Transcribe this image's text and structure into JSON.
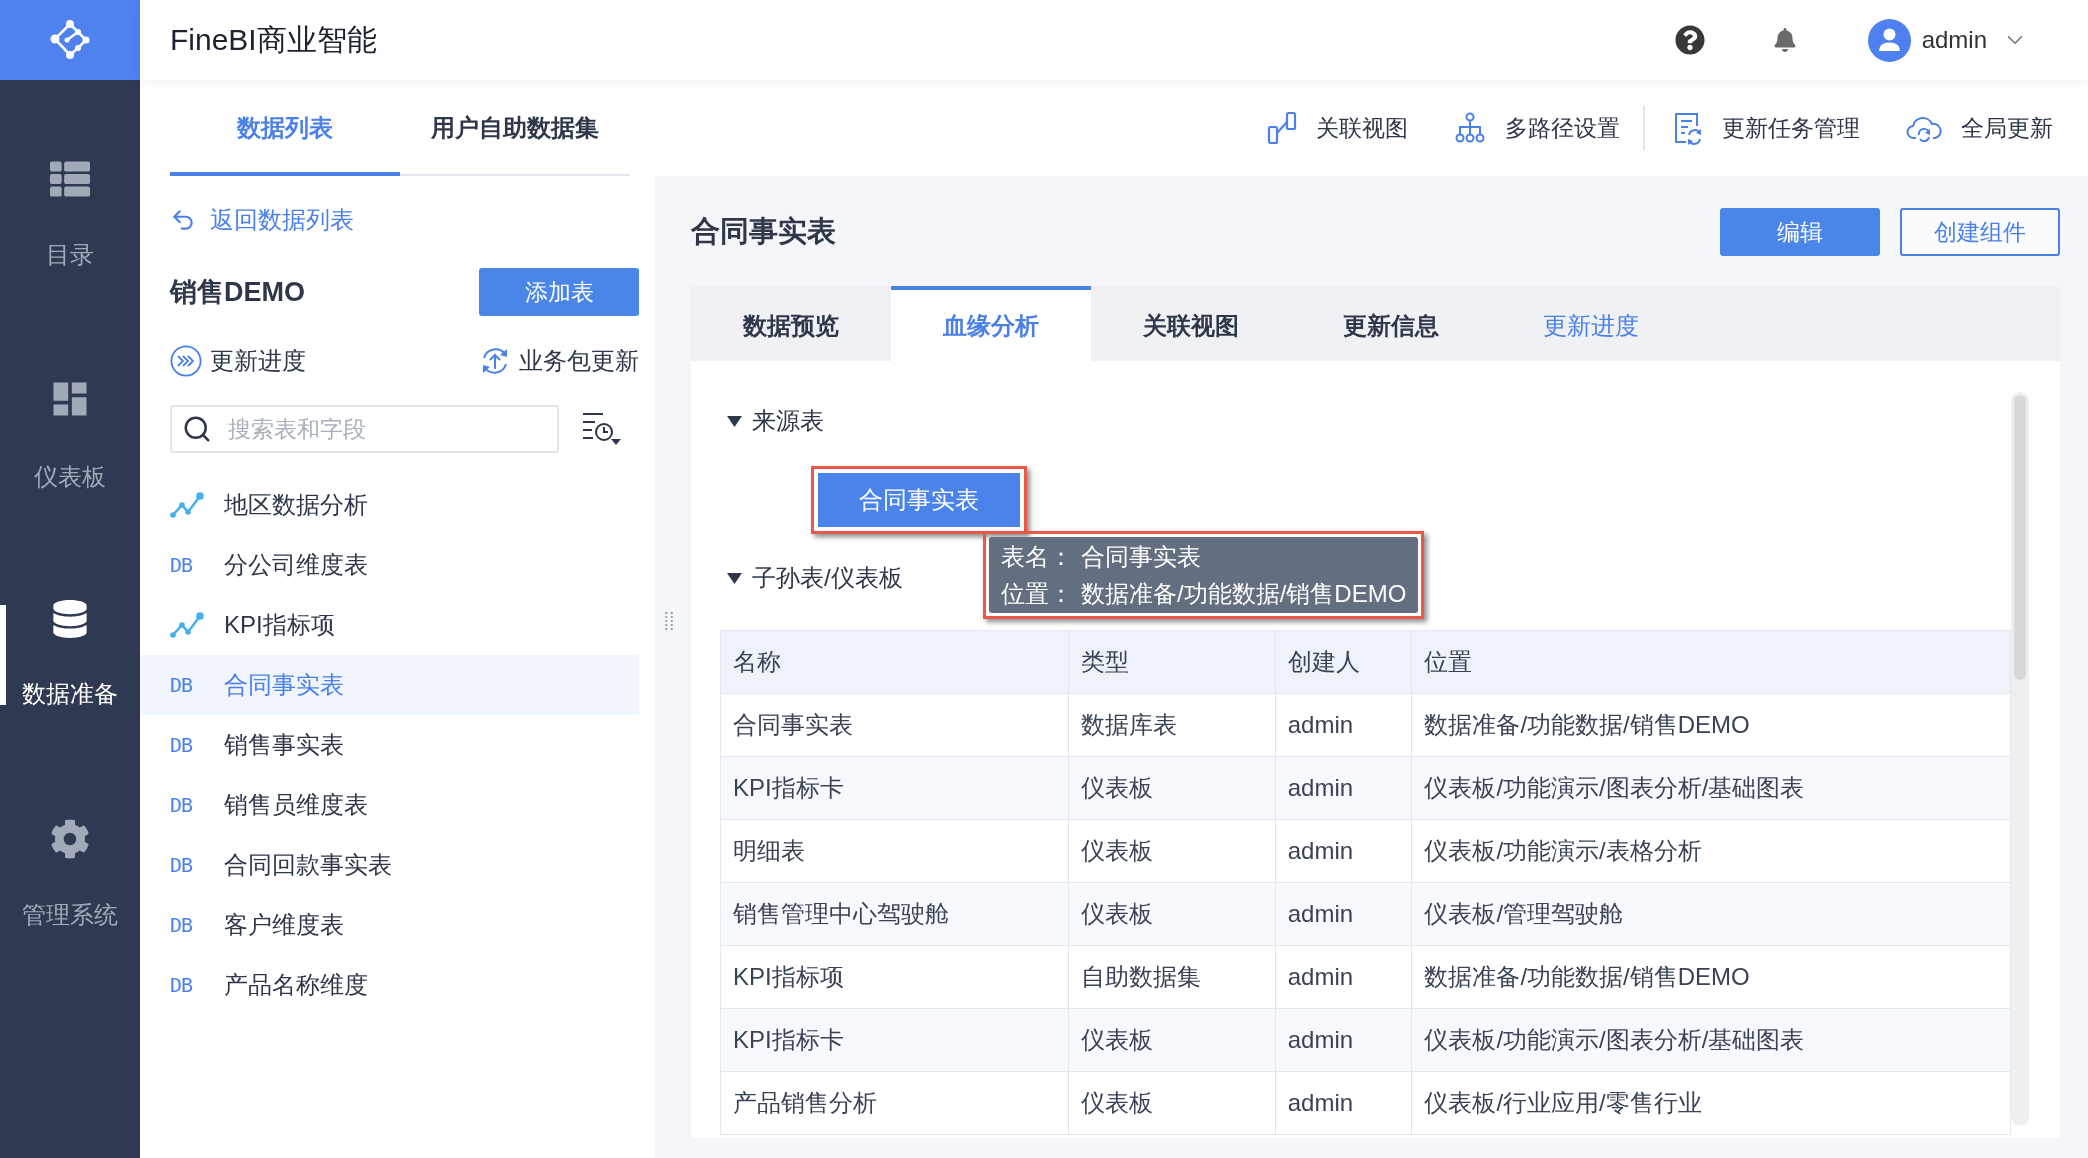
{
  "app": {
    "title": "FineBI商业智能",
    "user": "admin"
  },
  "nav": [
    {
      "label": "目录",
      "selected": false
    },
    {
      "label": "仪表板",
      "selected": false
    },
    {
      "label": "数据准备",
      "selected": true
    },
    {
      "label": "管理系统",
      "selected": false
    }
  ],
  "left_panel": {
    "tabs": [
      {
        "label": "数据列表",
        "selected": true
      },
      {
        "label": "用户自助数据集",
        "selected": false
      }
    ],
    "back_link": "返回数据列表",
    "package": {
      "name": "销售DEMO",
      "add_button": "添加表"
    },
    "actions": [
      "更新进度",
      "业务包更新"
    ],
    "search": {
      "placeholder": "搜索表和字段"
    },
    "items": [
      {
        "kind": "analysis",
        "label": "地区数据分析",
        "selected": false
      },
      {
        "kind": "db",
        "badge": "DB",
        "label": "分公司维度表",
        "selected": false
      },
      {
        "kind": "analysis",
        "label": "KPI指标项",
        "selected": false
      },
      {
        "kind": "db",
        "badge": "DB",
        "label": "合同事实表",
        "selected": true
      },
      {
        "kind": "db",
        "badge": "DB",
        "label": "销售事实表",
        "selected": false
      },
      {
        "kind": "db",
        "badge": "DB",
        "label": "销售员维度表",
        "selected": false
      },
      {
        "kind": "db",
        "badge": "DB",
        "label": "合同回款事实表",
        "selected": false
      },
      {
        "kind": "db",
        "badge": "DB",
        "label": "客户维度表",
        "selected": false
      },
      {
        "kind": "db",
        "badge": "DB",
        "label": "产品名称维度",
        "selected": false
      }
    ]
  },
  "toolbar": [
    [
      "关联视图",
      "多路径设置"
    ],
    [
      "更新任务管理",
      "全局更新"
    ]
  ],
  "detail": {
    "title": "合同事实表",
    "buttons": [
      {
        "label": "编辑",
        "kind": "primary"
      },
      {
        "label": "创建组件",
        "kind": "outline"
      }
    ],
    "tabs": [
      {
        "label": "数据预览",
        "selected": false,
        "hovered": false
      },
      {
        "label": "血缘分析",
        "selected": true,
        "hovered": false
      },
      {
        "label": "关联视图",
        "selected": false,
        "hovered": false
      },
      {
        "label": "更新信息",
        "selected": false,
        "hovered": false
      },
      {
        "label": "更新进度",
        "selected": false,
        "hovered": true
      }
    ],
    "sources": {
      "title": "来源表",
      "expanded": true,
      "node": {
        "label": "合同事实表",
        "highlighted": true
      },
      "tooltip": {
        "highlighted": true,
        "rows": [
          {
            "label": "表名：",
            "value": "合同事实表"
          },
          {
            "label": "位置：",
            "value": "数据准备/功能数据/销售DEMO"
          }
        ]
      }
    },
    "descendants": {
      "title": "子孙表/仪表板",
      "expanded": true,
      "columns": [
        "名称",
        "类型",
        "创建人",
        "位置"
      ],
      "rows": [
        [
          "合同事实表",
          "数据库表",
          "admin",
          "数据准备/功能数据/销售DEMO"
        ],
        [
          "KPI指标卡",
          "仪表板",
          "admin",
          "仪表板/功能演示/图表分析/基础图表"
        ],
        [
          "明细表",
          "仪表板",
          "admin",
          "仪表板/功能演示/表格分析"
        ],
        [
          "销售管理中心驾驶舱",
          "仪表板",
          "admin",
          "仪表板/管理驾驶舱"
        ],
        [
          "KPI指标项",
          "自助数据集",
          "admin",
          "数据准备/功能数据/销售DEMO"
        ],
        [
          "KPI指标卡",
          "仪表板",
          "admin",
          "仪表板/功能演示/图表分析/基础图表"
        ],
        [
          "产品销售分析",
          "仪表板",
          "admin",
          "仪表板/行业应用/零售行业"
        ]
      ]
    }
  }
}
